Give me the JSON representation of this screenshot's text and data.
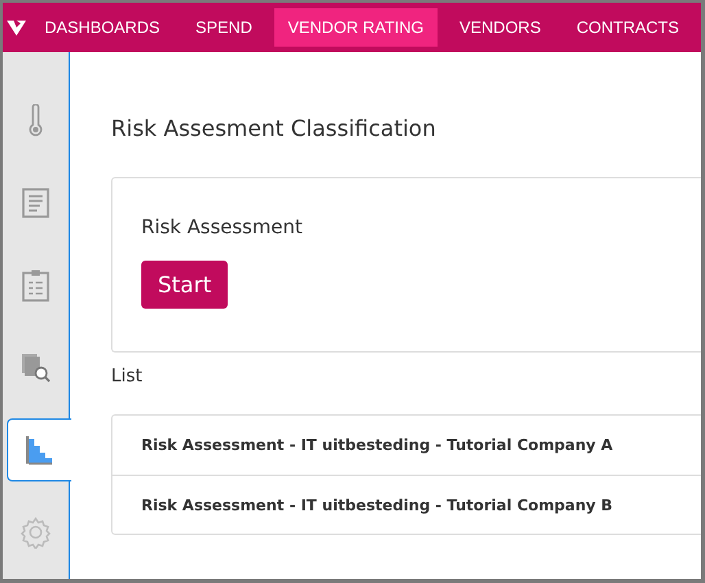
{
  "nav": {
    "items": [
      {
        "label": "DASHBOARDS",
        "selected": false
      },
      {
        "label": "SPEND",
        "selected": false
      },
      {
        "label": "VENDOR RATING",
        "selected": true
      },
      {
        "label": "VENDORS",
        "selected": false
      },
      {
        "label": "CONTRACTS",
        "selected": false
      }
    ]
  },
  "sidebar": {
    "items": [
      {
        "kind": "thermometer",
        "selected": false
      },
      {
        "kind": "document",
        "selected": false
      },
      {
        "kind": "clipboard",
        "selected": false
      },
      {
        "kind": "search-files",
        "selected": false
      },
      {
        "kind": "chart",
        "selected": true
      },
      {
        "kind": "settings",
        "selected": false
      }
    ]
  },
  "page_title": "Risk Assesment Classification",
  "card": {
    "heading": "Risk Assessment",
    "button": "Start"
  },
  "list": {
    "label": "List",
    "rows": [
      "Risk Assessment - IT uitbesteding - Tutorial Company A",
      "Risk Assessment - IT uitbesteding - Tutorial Company B"
    ]
  }
}
